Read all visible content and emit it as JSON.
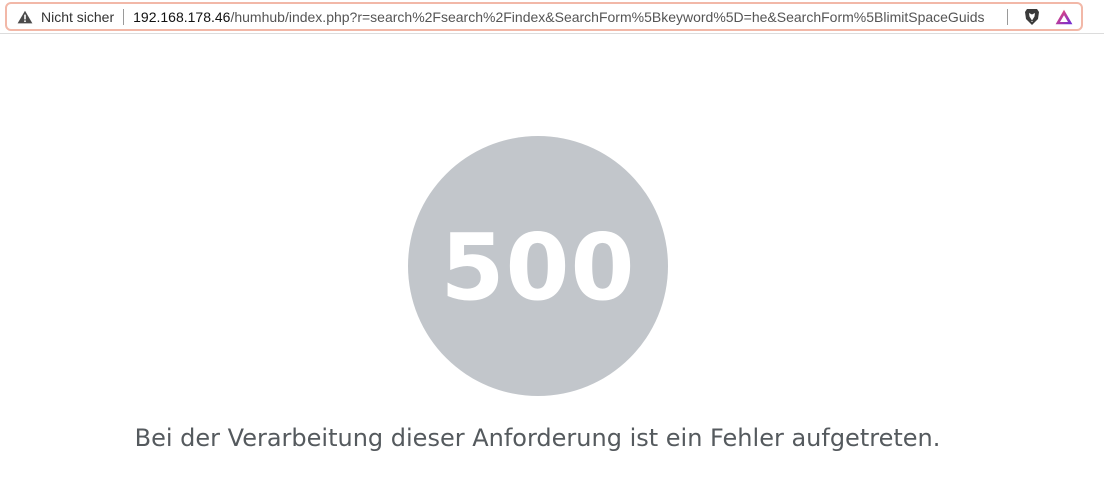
{
  "browser": {
    "security_label": "Nicht sicher",
    "url_host": "192.168.178.46",
    "url_path": "/humhub/index.php?r=search%2Fsearch%2Findex&SearchForm%5Bkeyword%5D=he&SearchForm%5BlimitSpaceGuids",
    "icons": {
      "warning": "warning-triangle-icon",
      "brave": "brave-lion-icon",
      "rewards": "brave-rewards-triangle-icon"
    },
    "colors": {
      "url_border": "#f2b8a8"
    }
  },
  "error": {
    "code": "500",
    "message": "Bei der Verarbeitung dieser Anforderung ist ein Fehler aufgetreten.",
    "circle_color": "#c2c6cb"
  }
}
